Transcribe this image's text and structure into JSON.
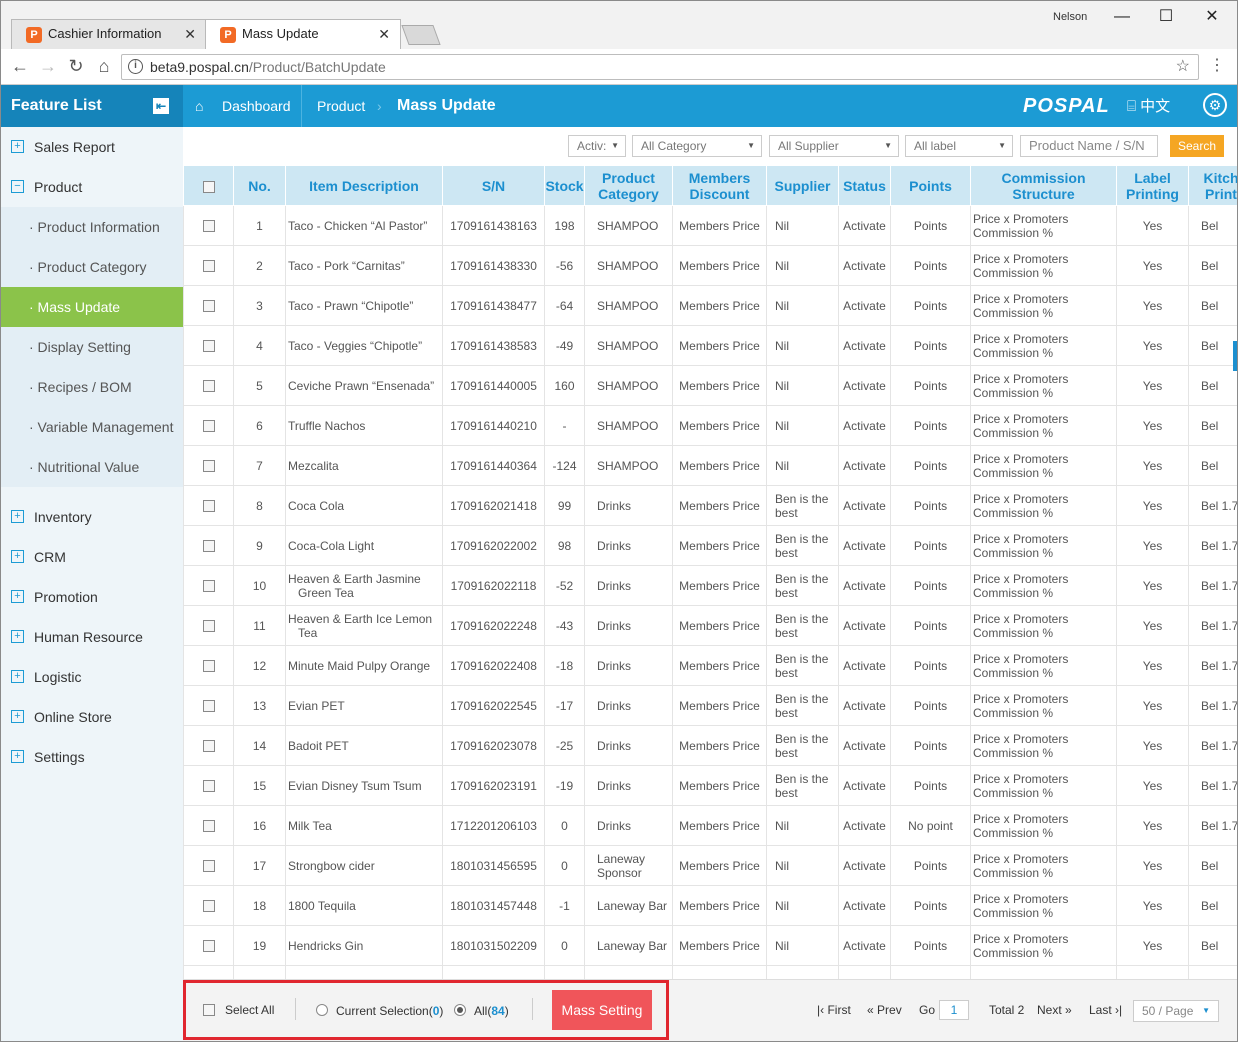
{
  "browser": {
    "tabs": [
      {
        "label": "Cashier Information"
      },
      {
        "label": "Mass Update"
      }
    ],
    "window_user": "Nelson",
    "url_host": "beta9.pospal.cn",
    "url_path": "/Product/BatchUpdate"
  },
  "header": {
    "feature_list": "Feature List",
    "breadcrumb": [
      "Dashboard",
      "Product",
      "Mass Update"
    ],
    "logo": "POSPAL",
    "lang": "中文"
  },
  "sidebar": {
    "items": [
      {
        "label": "Sales Report"
      },
      {
        "label": "Product"
      },
      {
        "label": "Inventory"
      },
      {
        "label": "CRM"
      },
      {
        "label": "Promotion"
      },
      {
        "label": "Human Resource"
      },
      {
        "label": "Logistic"
      },
      {
        "label": "Online Store"
      },
      {
        "label": "Settings"
      }
    ],
    "product_sub": [
      {
        "label": "· Product Information"
      },
      {
        "label": "· Product Category"
      },
      {
        "label": "· Mass Update"
      },
      {
        "label": "· Display Setting"
      },
      {
        "label": "· Recipes / BOM"
      },
      {
        "label": "· Variable Management"
      },
      {
        "label": "· Nutritional Value"
      }
    ]
  },
  "filters": {
    "status": "Activ:",
    "category": "All Category",
    "supplier": "All Supplier",
    "label": "All label",
    "search_placeholder": "Product Name / S/N",
    "search_btn": "Search"
  },
  "table": {
    "columns": [
      "No.",
      "Item Description",
      "S/N",
      "Stock",
      "Product Category",
      "Members Discount",
      "Supplier",
      "Status",
      "Points",
      "Commission Structure",
      "Label Printing",
      "Kitch Print"
    ],
    "rows": [
      [
        "1",
        "Taco - Chicken “Al Pastor”",
        "1709161438163",
        "198",
        "SHAMPOO",
        "Members Price",
        "Nil",
        "Activate",
        "Points",
        "Price x Promoters Commission %",
        "Yes",
        "Bel"
      ],
      [
        "2",
        "Taco - Pork “Carnitas”",
        "1709161438330",
        "-56",
        "SHAMPOO",
        "Members Price",
        "Nil",
        "Activate",
        "Points",
        "Price x Promoters Commission %",
        "Yes",
        "Bel"
      ],
      [
        "3",
        "Taco - Prawn “Chipotle”",
        "1709161438477",
        "-64",
        "SHAMPOO",
        "Members Price",
        "Nil",
        "Activate",
        "Points",
        "Price x Promoters Commission %",
        "Yes",
        "Bel"
      ],
      [
        "4",
        "Taco - Veggies “Chipotle”",
        "1709161438583",
        "-49",
        "SHAMPOO",
        "Members Price",
        "Nil",
        "Activate",
        "Points",
        "Price x Promoters Commission %",
        "Yes",
        "Bel"
      ],
      [
        "5",
        "Ceviche Prawn “Ensenada”",
        "1709161440005",
        "160",
        "SHAMPOO",
        "Members Price",
        "Nil",
        "Activate",
        "Points",
        "Price x Promoters Commission %",
        "Yes",
        "Bel"
      ],
      [
        "6",
        "Truffle Nachos",
        "1709161440210",
        "-",
        "SHAMPOO",
        "Members Price",
        "Nil",
        "Activate",
        "Points",
        "Price x Promoters Commission %",
        "Yes",
        "Bel"
      ],
      [
        "7",
        "Mezcalita",
        "1709161440364",
        "-124",
        "SHAMPOO",
        "Members Price",
        "Nil",
        "Activate",
        "Points",
        "Price x Promoters Commission %",
        "Yes",
        "Bel"
      ],
      [
        "8",
        "Coca Cola",
        "1709162021418",
        "99",
        "Drinks",
        "Members Price",
        "Ben is the best",
        "Activate",
        "Points",
        "Price x Promoters Commission %",
        "Yes",
        "Bel 1.7"
      ],
      [
        "9",
        "Coca-Cola Light",
        "1709162022002",
        "98",
        "Drinks",
        "Members Price",
        "Ben is the best",
        "Activate",
        "Points",
        "Price x Promoters Commission %",
        "Yes",
        "Bel 1.7"
      ],
      [
        "10",
        "Heaven & Earth Jasmine Green Tea",
        "1709162022118",
        "-52",
        "Drinks",
        "Members Price",
        "Ben is the best",
        "Activate",
        "Points",
        "Price x Promoters Commission %",
        "Yes",
        "Bel 1.7"
      ],
      [
        "11",
        "Heaven & Earth Ice Lemon Tea",
        "1709162022248",
        "-43",
        "Drinks",
        "Members Price",
        "Ben is the best",
        "Activate",
        "Points",
        "Price x Promoters Commission %",
        "Yes",
        "Bel 1.7"
      ],
      [
        "12",
        "Minute Maid Pulpy Orange",
        "1709162022408",
        "-18",
        "Drinks",
        "Members Price",
        "Ben is the best",
        "Activate",
        "Points",
        "Price x Promoters Commission %",
        "Yes",
        "Bel 1.7"
      ],
      [
        "13",
        "Evian PET",
        "1709162022545",
        "-17",
        "Drinks",
        "Members Price",
        "Ben is the best",
        "Activate",
        "Points",
        "Price x Promoters Commission %",
        "Yes",
        "Bel 1.7"
      ],
      [
        "14",
        "Badoit PET",
        "1709162023078",
        "-25",
        "Drinks",
        "Members Price",
        "Ben is the best",
        "Activate",
        "Points",
        "Price x Promoters Commission %",
        "Yes",
        "Bel 1.7"
      ],
      [
        "15",
        "Evian Disney Tsum Tsum",
        "1709162023191",
        "-19",
        "Drinks",
        "Members Price",
        "Ben is the best",
        "Activate",
        "Points",
        "Price x Promoters Commission %",
        "Yes",
        "Bel 1.7"
      ],
      [
        "16",
        "Milk Tea",
        "1712201206103",
        "0",
        "Drinks",
        "Members Price",
        "Nil",
        "Activate",
        "No point",
        "Price x Promoters Commission %",
        "Yes",
        "Bel 1.7"
      ],
      [
        "17",
        "Strongbow cider",
        "1801031456595",
        "0",
        "Laneway Sponsor",
        "Members Price",
        "Nil",
        "Activate",
        "Points",
        "Price x Promoters Commission %",
        "Yes",
        "Bel"
      ],
      [
        "18",
        "1800 Tequila",
        "1801031457448",
        "-1",
        "Laneway Bar",
        "Members Price",
        "Nil",
        "Activate",
        "Points",
        "Price x Promoters Commission %",
        "Yes",
        "Bel"
      ],
      [
        "19",
        "Hendricks Gin",
        "1801031502209",
        "0",
        "Laneway Bar",
        "Members Price",
        "Nil",
        "Activate",
        "Points",
        "Price x Promoters Commission %",
        "Yes",
        "Bel"
      ],
      [
        "",
        "",
        "",
        "",
        "",
        "",
        "",
        "",
        "",
        "Price x Promoters",
        "",
        ""
      ]
    ]
  },
  "footer": {
    "select_all": "Select All",
    "current_selection_label": "Current Selection(",
    "current_selection_count": "0",
    "all_label": "All(",
    "all_count": "84",
    "close_paren": ")",
    "mass_setting": "Mass Setting",
    "first": "First",
    "prev": "Prev",
    "go": "Go",
    "page": "1",
    "total": "Total 2",
    "next": "Next",
    "last": "Last",
    "per_page": "50 / Page"
  }
}
